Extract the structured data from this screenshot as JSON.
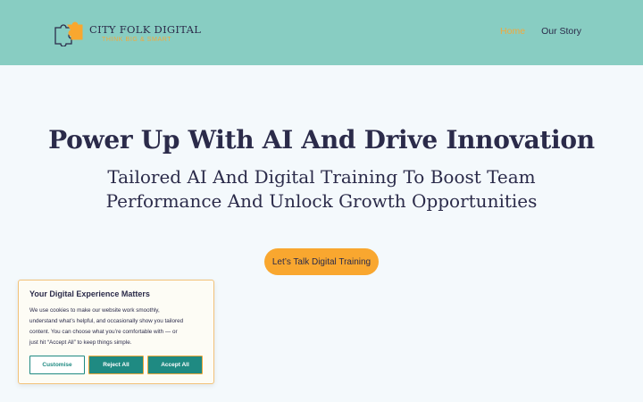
{
  "colors": {
    "header_bg": "#88cdc2",
    "accent": "#f9a72f",
    "teal": "#1f8a82",
    "text": "#2b2b4a",
    "page_bg": "#f4f9fc"
  },
  "brand": {
    "name": "CITY FOLK DIGITAL",
    "tagline": "THINK BIG & SMART",
    "icon": "puzzle-piece-icon"
  },
  "nav": {
    "items": [
      {
        "label": "Home",
        "active": true
      },
      {
        "label": "Our Story",
        "active": false
      }
    ]
  },
  "hero": {
    "title": "Power Up With AI And Drive Innovation",
    "subtitle_line1": "Tailored AI And Digital Training To Boost Team",
    "subtitle_line2": "Performance And Unlock Growth Opportunities",
    "cta_label": "Let’s Talk Digital Training"
  },
  "cookie_banner": {
    "title": "Your Digital Experience Matters",
    "body_lines": [
      "We use cookies to make our website work smoothly,",
      "understand what’s helpful, and occasionally show you tailored",
      "content. You can choose what you’re comfortable with — or",
      "just hit “Accept All” to keep things simple."
    ],
    "customise_label": "Customise",
    "reject_label": "Reject All",
    "accept_label": "Accept All"
  }
}
